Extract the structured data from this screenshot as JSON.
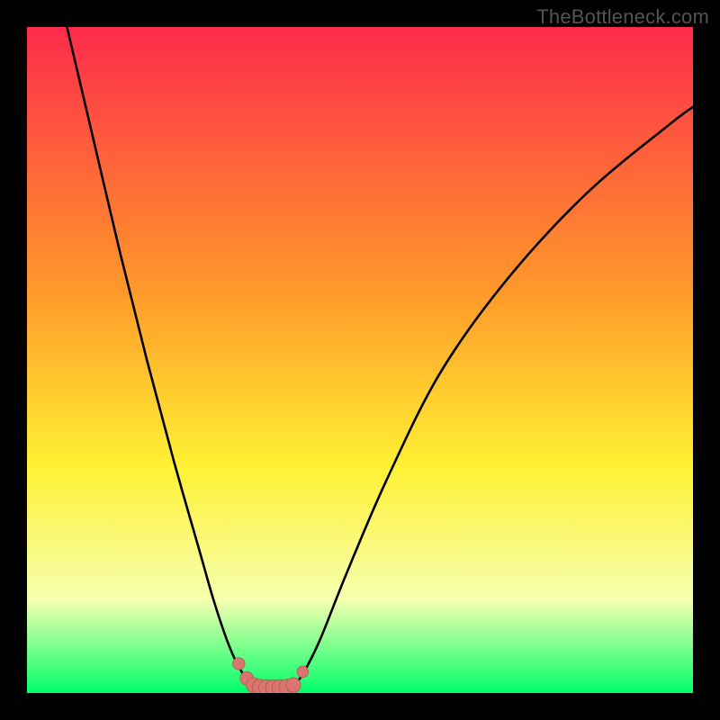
{
  "watermark": "TheBottleneck.com",
  "colors": {
    "gradient_top": "#fd2b4b",
    "gradient_mid1": "#ff9a2a",
    "gradient_mid2": "#fff133",
    "gradient_mid3": "#f6ffb0",
    "gradient_bottom": "#00ff6a",
    "curve": "#000000",
    "marker_fill": "#d8766f",
    "marker_stroke": "#b95a52"
  },
  "chart_data": {
    "type": "line",
    "title": "",
    "xlabel": "",
    "ylabel": "",
    "xlim": [
      0,
      100
    ],
    "ylim": [
      0,
      100
    ],
    "grid": false,
    "legend": false,
    "note": "No axis ticks or numeric labels are rendered; values are schematic positions read off the image (0–100 each axis, y=0 at bottom).",
    "series": [
      {
        "name": "left-branch",
        "x": [
          6,
          10,
          14,
          18,
          22,
          26,
          28,
          30,
          31.5,
          33,
          34
        ],
        "y": [
          100,
          83,
          66,
          50,
          35,
          21,
          14,
          8,
          4.5,
          2,
          1
        ]
      },
      {
        "name": "right-branch",
        "x": [
          40,
          41.5,
          44,
          48,
          54,
          62,
          72,
          84,
          96,
          100
        ],
        "y": [
          1,
          3,
          8,
          18,
          32,
          48,
          62,
          75,
          85,
          88
        ]
      },
      {
        "name": "valley-floor",
        "x": [
          34,
          35,
          36,
          37,
          38,
          39,
          40
        ],
        "y": [
          1,
          0.7,
          0.6,
          0.6,
          0.6,
          0.7,
          1
        ]
      }
    ],
    "markers": {
      "name": "optimal-band",
      "x": [
        31.8,
        33.0,
        34.0,
        35.0,
        36.0,
        37.0,
        38.0,
        39.0,
        40.0,
        41.4
      ],
      "y": [
        4.4,
        2.2,
        1.2,
        0.9,
        0.8,
        0.8,
        0.8,
        0.9,
        1.2,
        3.2
      ],
      "r": [
        0.9,
        1.0,
        1.1,
        1.15,
        1.2,
        1.2,
        1.2,
        1.15,
        1.1,
        0.85
      ]
    }
  }
}
